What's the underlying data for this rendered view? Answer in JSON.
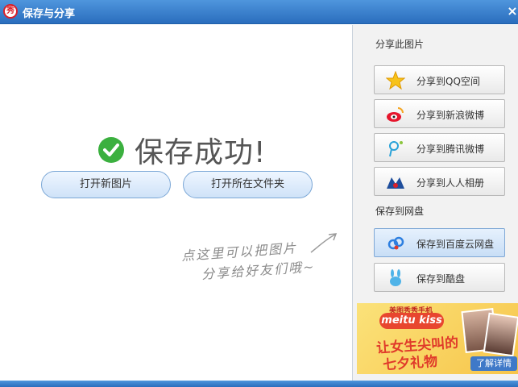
{
  "window": {
    "title": "保存与分享",
    "app_logo_text": "秀",
    "close_symbol": "×"
  },
  "main": {
    "success_message": "保存成功!",
    "open_new_image": "打开新图片",
    "open_folder": "打开所在文件夹",
    "hint_line1": "点这里可以把图片",
    "hint_line2": "分享给好友们哦~"
  },
  "sidebar": {
    "share_section_label": "分享此图片",
    "share_buttons": [
      {
        "label": "分享到QQ空间",
        "icon": "qzone-star-icon"
      },
      {
        "label": "分享到新浪微博",
        "icon": "sina-weibo-icon"
      },
      {
        "label": "分享到腾讯微博",
        "icon": "tencent-weibo-icon"
      },
      {
        "label": "分享到人人相册",
        "icon": "renren-icon"
      }
    ],
    "save_section_label": "保存到网盘",
    "save_buttons": [
      {
        "label": "保存到百度云网盘",
        "icon": "baidu-cloud-icon"
      },
      {
        "label": "保存到酷盘",
        "icon": "kupan-rabbit-icon"
      }
    ]
  },
  "ad": {
    "brand": "美图秀秀手机",
    "logo": "meitu kiss",
    "slogan_line1": "让女生尖叫的",
    "slogan_line2": "七夕礼物",
    "cta": "了解详情"
  },
  "colors": {
    "titlebar": "#2a6dbd",
    "success_green": "#3bb03f",
    "pill_border": "#7ba7d6",
    "sidebar_bg": "#f2f2f2"
  }
}
